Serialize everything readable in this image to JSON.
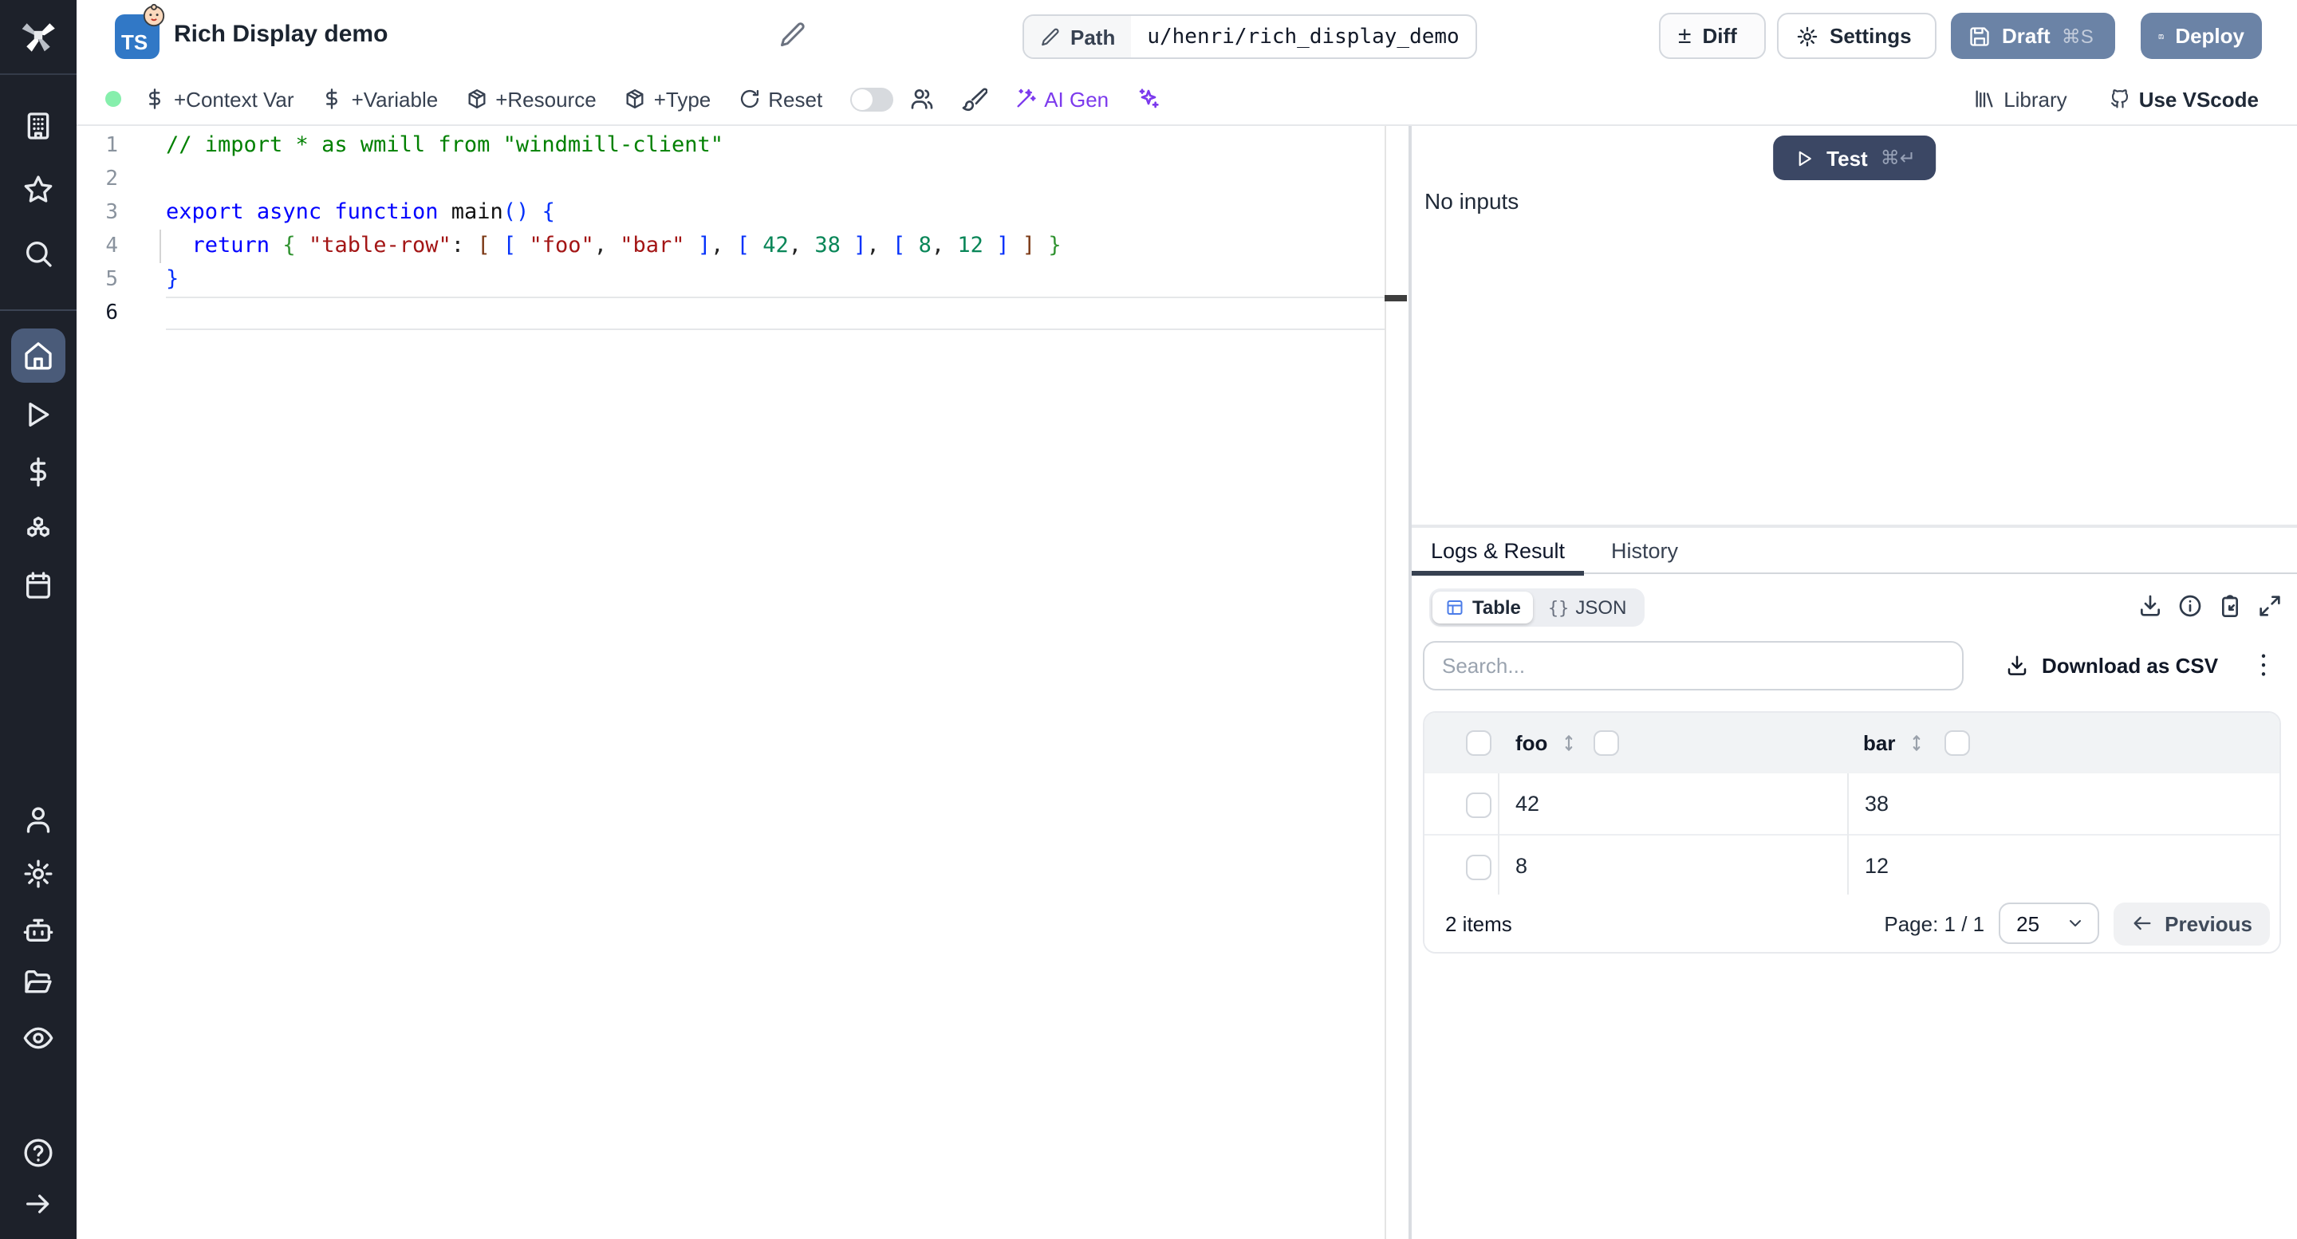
{
  "colors": {
    "deploy_blue": "#6b83a6",
    "test_navy": "#3b4764",
    "ai_purple": "#7c3aed",
    "status_green": "#86efac",
    "ts_blue": "#3178c6",
    "table_icon_blue": "#4b7ce8"
  },
  "header": {
    "language_badge": "TS",
    "emoji_badge": "baby-face-emoji",
    "title": "Rich Display demo",
    "path_label": "Path",
    "path_value": "u/henri/rich_display_demo",
    "diff_label": "Diff",
    "diff_icon": "±",
    "settings_label": "Settings",
    "draft_label": "Draft",
    "draft_shortcut": "⌘S",
    "deploy_label": "Deploy"
  },
  "toolbar": {
    "context_var": "+Context Var",
    "variable": "+Variable",
    "resource": "+Resource",
    "type": "+Type",
    "reset": "Reset",
    "ai_gen": "AI Gen",
    "library": "Library",
    "vscode": "Use VScode"
  },
  "sidebar": {
    "top_items": [
      "building-icon",
      "star-icon",
      "search-icon"
    ],
    "main_items": [
      "home-icon",
      "play-icon",
      "dollar-icon",
      "boxes-icon",
      "calendar-icon"
    ],
    "lower_items": [
      "user-icon",
      "gear-icon",
      "bot-icon",
      "folder-icon",
      "eye-icon"
    ],
    "bottom_items": [
      "help-icon",
      "arrow-right-icon"
    ],
    "active_item": "home-icon"
  },
  "editor": {
    "active_line": 6,
    "lines": [
      {
        "num": 1,
        "tokens": [
          [
            "// import * as wmill from \"windmill-client\"",
            "cm"
          ]
        ]
      },
      {
        "num": 2,
        "tokens": []
      },
      {
        "num": 3,
        "tokens": [
          [
            "export",
            "kw"
          ],
          [
            " ",
            "pl"
          ],
          [
            "async",
            "kw"
          ],
          [
            " ",
            "pl"
          ],
          [
            "function",
            "kw"
          ],
          [
            " ",
            "pl"
          ],
          [
            "main",
            "fn"
          ],
          [
            "(",
            "b1"
          ],
          [
            ")",
            "b1"
          ],
          [
            " ",
            "pl"
          ],
          [
            "{",
            "b1"
          ]
        ]
      },
      {
        "num": 4,
        "tokens": [
          [
            "  ",
            "pl"
          ],
          [
            "return",
            "kw"
          ],
          [
            " ",
            "pl"
          ],
          [
            "{",
            "b2"
          ],
          [
            " ",
            "pl"
          ],
          [
            "\"table-row\"",
            "st"
          ],
          [
            ":",
            "pl"
          ],
          [
            " ",
            "pl"
          ],
          [
            "[",
            "b3"
          ],
          [
            " ",
            "pl"
          ],
          [
            "[",
            "b1"
          ],
          [
            " ",
            "pl"
          ],
          [
            "\"foo\"",
            "st"
          ],
          [
            ",",
            "pl"
          ],
          [
            " ",
            "pl"
          ],
          [
            "\"bar\"",
            "st"
          ],
          [
            " ",
            "pl"
          ],
          [
            "]",
            "b1"
          ],
          [
            ",",
            "pl"
          ],
          [
            " ",
            "pl"
          ],
          [
            "[",
            "b1"
          ],
          [
            " ",
            "pl"
          ],
          [
            "42",
            "nu"
          ],
          [
            ",",
            "pl"
          ],
          [
            " ",
            "pl"
          ],
          [
            "38",
            "nu"
          ],
          [
            " ",
            "pl"
          ],
          [
            "]",
            "b1"
          ],
          [
            ",",
            "pl"
          ],
          [
            " ",
            "pl"
          ],
          [
            "[",
            "b1"
          ],
          [
            " ",
            "pl"
          ],
          [
            "8",
            "nu"
          ],
          [
            ",",
            "pl"
          ],
          [
            " ",
            "pl"
          ],
          [
            "12",
            "nu"
          ],
          [
            " ",
            "pl"
          ],
          [
            "]",
            "b1"
          ],
          [
            " ",
            "pl"
          ],
          [
            "]",
            "b3"
          ],
          [
            " ",
            "pl"
          ],
          [
            "}",
            "b2"
          ]
        ]
      },
      {
        "num": 5,
        "tokens": [
          [
            "}",
            "b1"
          ]
        ]
      },
      {
        "num": 6,
        "tokens": []
      }
    ]
  },
  "run_panel": {
    "test_label": "Test",
    "test_shortcut": "⌘↵",
    "no_inputs": "No inputs"
  },
  "result_panel": {
    "tab_logs": "Logs & Result",
    "tab_history": "History",
    "view_table": "Table",
    "view_json_prefix": "{}",
    "view_json": "JSON",
    "action_icons": [
      "download-icon",
      "info-icon",
      "clipboard-icon",
      "expand-icon"
    ],
    "search_placeholder": "Search...",
    "download_csv": "Download as CSV"
  },
  "result_table": {
    "columns": [
      "foo",
      "bar"
    ],
    "rows": [
      [
        "42",
        "38"
      ],
      [
        "8",
        "12"
      ]
    ],
    "items_label": "2 items",
    "page_label": "Page: 1 / 1",
    "per_page": "25",
    "previous_label": "Previous"
  }
}
